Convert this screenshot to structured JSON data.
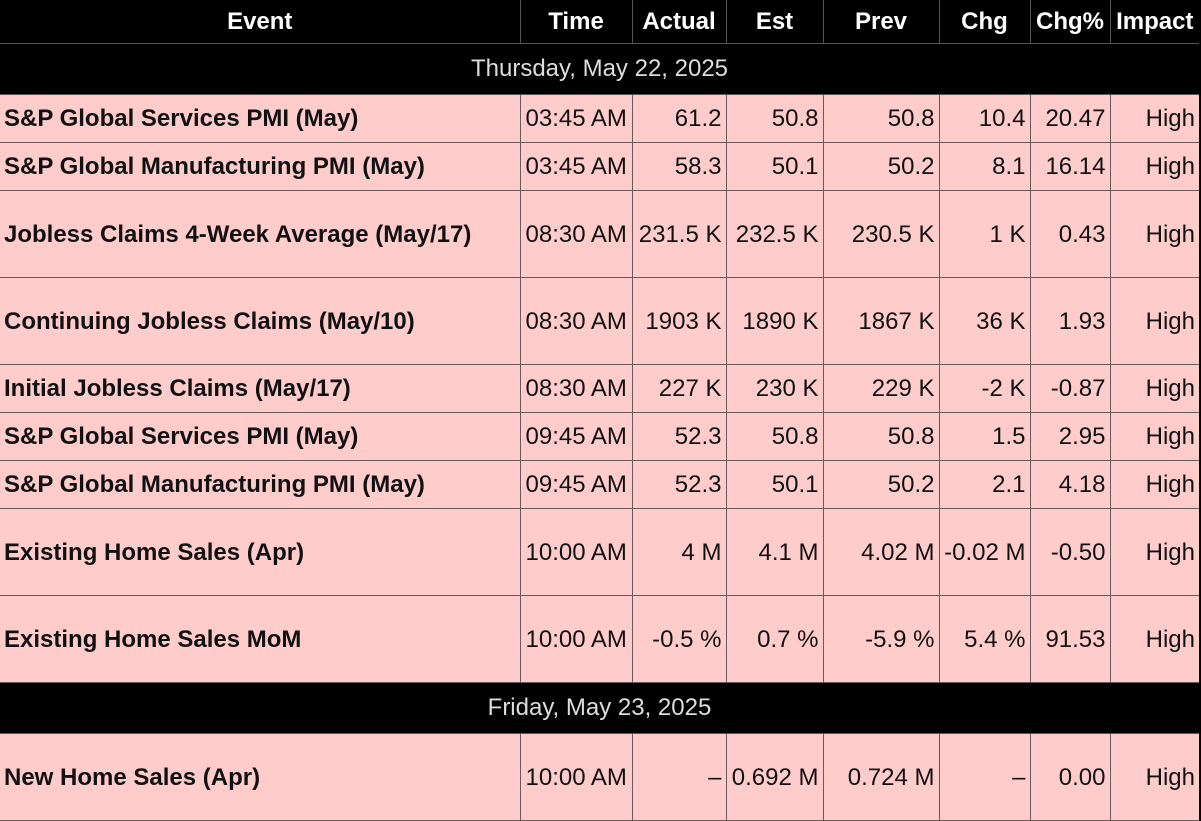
{
  "columns": {
    "event": "Event",
    "time": "Time",
    "actual": "Actual",
    "est": "Est",
    "prev": "Prev",
    "chg": "Chg",
    "chg_pct": "Chg%",
    "impact": "Impact"
  },
  "sections": [
    {
      "date": "Thursday, May 22, 2025",
      "rows": [
        {
          "event": "S&P Global Services PMI (May)",
          "time": "03:45 AM",
          "actual": "61.2",
          "est": "50.8",
          "prev": "50.8",
          "chg": "10.4",
          "chg_pct": "20.47",
          "impact": "High"
        },
        {
          "event": "S&P Global Manufacturing PMI (May)",
          "time": "03:45 AM",
          "actual": "58.3",
          "est": "50.1",
          "prev": "50.2",
          "chg": "8.1",
          "chg_pct": "16.14",
          "impact": "High"
        },
        {
          "event": "Jobless Claims 4-Week Average (May/17)",
          "time": "08:30 AM",
          "actual": "231.5 K",
          "est": "232.5 K",
          "prev": "230.5 K",
          "chg": "1 K",
          "chg_pct": "0.43",
          "impact": "High"
        },
        {
          "event": "Continuing Jobless Claims (May/10)",
          "time": "08:30 AM",
          "actual": "1903 K",
          "est": "1890 K",
          "prev": "1867 K",
          "chg": "36 K",
          "chg_pct": "1.93",
          "impact": "High"
        },
        {
          "event": "Initial Jobless Claims (May/17)",
          "time": "08:30 AM",
          "actual": "227 K",
          "est": "230 K",
          "prev": "229 K",
          "chg": "-2 K",
          "chg_pct": "-0.87",
          "impact": "High"
        },
        {
          "event": "S&P Global Services PMI (May)",
          "time": "09:45 AM",
          "actual": "52.3",
          "est": "50.8",
          "prev": "50.8",
          "chg": "1.5",
          "chg_pct": "2.95",
          "impact": "High"
        },
        {
          "event": "S&P Global Manufacturing PMI (May)",
          "time": "09:45 AM",
          "actual": "52.3",
          "est": "50.1",
          "prev": "50.2",
          "chg": "2.1",
          "chg_pct": "4.18",
          "impact": "High"
        },
        {
          "event": "Existing Home Sales (Apr)",
          "time": "10:00 AM",
          "actual": "4 M",
          "est": "4.1 M",
          "prev": "4.02 M",
          "chg": "-0.02 M",
          "chg_pct": "-0.50",
          "impact": "High"
        },
        {
          "event": "Existing Home Sales MoM",
          "time": "10:00 AM",
          "actual": "-0.5 %",
          "est": "0.7 %",
          "prev": "-5.9 %",
          "chg": "5.4 %",
          "chg_pct": "91.53",
          "impact": "High"
        }
      ]
    },
    {
      "date": "Friday, May 23, 2025",
      "rows": [
        {
          "event": "New Home Sales (Apr)",
          "time": "10:00 AM",
          "actual": "–",
          "est": "0.692 M",
          "prev": "0.724 M",
          "chg": "–",
          "chg_pct": "0.00",
          "impact": "High"
        }
      ]
    }
  ],
  "colors": {
    "header_bg": "#000000",
    "header_text": "#ffffff",
    "row_bg": "#ffcccc",
    "date_text": "#dddddd"
  }
}
